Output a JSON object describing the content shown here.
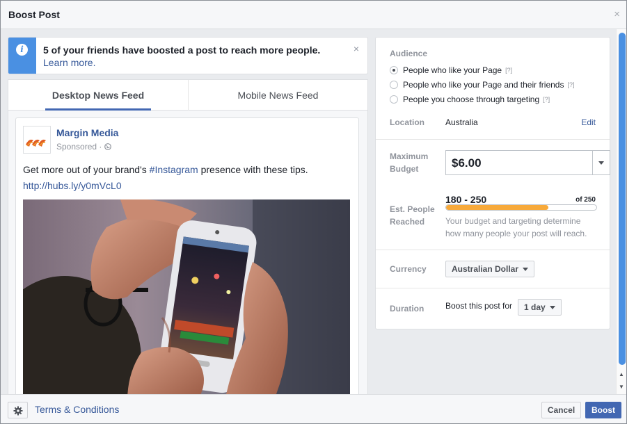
{
  "dialog": {
    "title": "Boost Post",
    "close_glyph": "×"
  },
  "notice": {
    "icon_glyph": "i",
    "text": "5 of your friends have boosted a post to reach more people.",
    "link": "Learn more.",
    "close_glyph": "×"
  },
  "tabs": [
    {
      "label": "Desktop News Feed",
      "active": true
    },
    {
      "label": "Mobile News Feed",
      "active": false
    }
  ],
  "post": {
    "page_name": "Margin Media",
    "sponsored": "Sponsored · ",
    "text_before": "Get more out of your brand's ",
    "hashtag": "#Instagram",
    "text_after": " presence with these tips.",
    "link": "http://hubs.ly/y0mVcL0",
    "image_icon": "photo-hands-holding-smartphone"
  },
  "audience": {
    "label": "Audience",
    "options": [
      {
        "label": "People who like your Page",
        "help": "[?]",
        "selected": true
      },
      {
        "label": "People who like your Page and their friends",
        "help": "[?]",
        "selected": false
      },
      {
        "label": "People you choose through targeting",
        "help": "[?]",
        "selected": false
      }
    ]
  },
  "location": {
    "label": "Location",
    "value": "Australia",
    "edit": "Edit"
  },
  "budget": {
    "label": "Maximum Budget",
    "value": "$6.00"
  },
  "reach": {
    "label": "Est. People Reached",
    "range": "180 - 250",
    "of": "of 250",
    "fill_percent": 68,
    "note": "Your budget and targeting determine how many people your post will reach."
  },
  "currency": {
    "label": "Currency",
    "value": "Australian Dollar"
  },
  "duration": {
    "label": "Duration",
    "prefix": "Boost this post for",
    "value": "1 day"
  },
  "footer": {
    "terms": "Terms & Conditions",
    "cancel": "Cancel",
    "boost": "Boost"
  },
  "colors": {
    "accent": "#4267b2",
    "link": "#365899",
    "info_blue": "#4a90e2",
    "reach_orange": "#f7a93a"
  }
}
